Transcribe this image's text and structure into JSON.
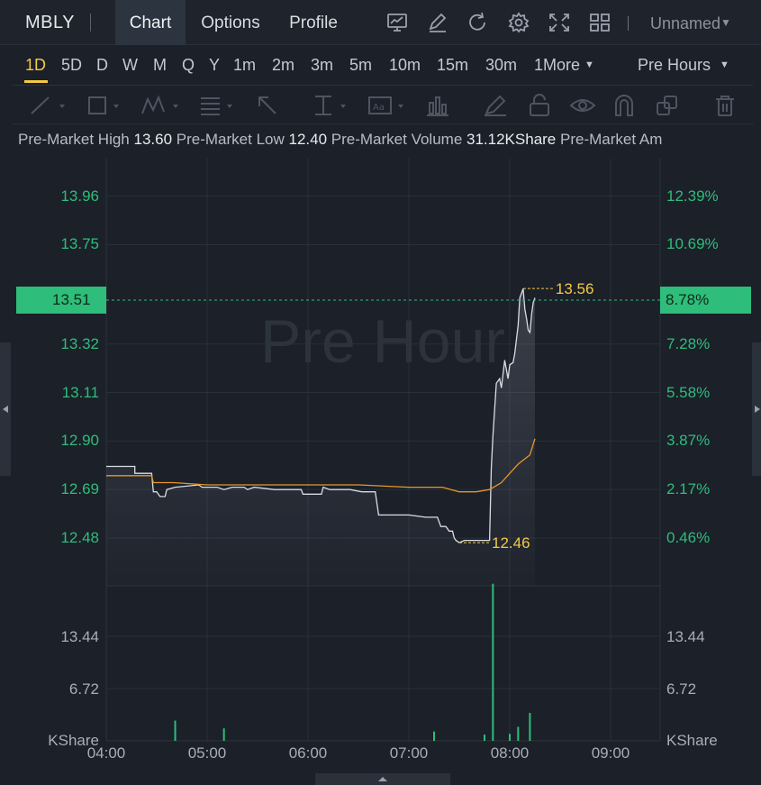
{
  "nav": {
    "symbol": "MBLY",
    "tabs": [
      "Chart",
      "Options",
      "Profile"
    ],
    "layout_name": "Unnamed",
    "toolbar_icons": [
      "indicator-icon",
      "draw-icon",
      "refresh-icon",
      "settings-icon",
      "fullscreen-icon",
      "layout-grid-icon"
    ]
  },
  "intervals": {
    "items": [
      "1D",
      "5D",
      "D",
      "W",
      "M",
      "Q",
      "Y",
      "1m",
      "2m",
      "3m",
      "5m",
      "10m",
      "15m",
      "30m",
      "1"
    ],
    "more_label": "More",
    "active": "1D",
    "session": "Pre Hours"
  },
  "drawing_tools": [
    "trend-line-icon",
    "rectangle-icon",
    "pattern-icon",
    "fib-icon",
    "arrow-icon",
    "measure-icon",
    "text-note-icon",
    "bar-pattern-icon",
    "brush-icon",
    "lock-icon",
    "eye-icon",
    "magnet-icon",
    "clone-icon",
    "trash-icon"
  ],
  "stats": {
    "high_label": "Pre-Market High",
    "high": "13.60",
    "low_label": "Pre-Market Low",
    "low": "12.40",
    "volume_label": "Pre-Market Volume",
    "volume": "31.12KShare",
    "amount_label": "Pre-Market Am"
  },
  "colors": {
    "up": "#2ebd7a",
    "price_line": "#d9dde3",
    "avg_line": "#e8962b",
    "highlight": "#f5c945"
  },
  "watermark": "Pre Hour",
  "chart_data": {
    "type": "line",
    "price_axis": [
      "13.96",
      "13.75",
      "13.51",
      "13.32",
      "13.11",
      "12.90",
      "12.69",
      "12.48"
    ],
    "percent_axis": [
      "12.39%",
      "10.69%",
      "8.78%",
      "7.28%",
      "5.58%",
      "3.87%",
      "2.17%",
      "0.46%"
    ],
    "current_price": "13.51",
    "current_percent": "8.78%",
    "max_label": "13.56",
    "min_label": "12.46",
    "ylim": [
      12.42,
      14.04
    ],
    "x_ticks": [
      "04:00",
      "05:00",
      "06:00",
      "07:00",
      "08:00",
      "09:00"
    ],
    "x_range": [
      0,
      300
    ],
    "volume_axis": [
      "13.44",
      "6.72"
    ],
    "volume_unit": "KShare",
    "volume_max": 20.2,
    "series": [
      {
        "kind": "price",
        "points": [
          [
            0,
            12.79
          ],
          [
            16,
            12.79
          ],
          [
            17,
            12.79
          ],
          [
            17,
            12.76
          ],
          [
            27,
            12.76
          ],
          [
            28,
            12.68
          ],
          [
            30,
            12.68
          ],
          [
            32,
            12.66
          ],
          [
            35,
            12.66
          ],
          [
            36,
            12.69
          ],
          [
            41,
            12.7
          ],
          [
            55,
            12.71
          ],
          [
            57,
            12.7
          ],
          [
            66,
            12.7
          ],
          [
            70,
            12.69
          ],
          [
            75,
            12.7
          ],
          [
            82,
            12.7
          ],
          [
            84,
            12.69
          ],
          [
            88,
            12.7
          ],
          [
            100,
            12.69
          ],
          [
            116,
            12.69
          ],
          [
            117,
            12.67
          ],
          [
            128,
            12.67
          ],
          [
            129,
            12.7
          ],
          [
            133,
            12.69
          ],
          [
            145,
            12.69
          ],
          [
            152,
            12.68
          ],
          [
            160,
            12.68
          ],
          [
            162,
            12.58
          ],
          [
            180,
            12.58
          ],
          [
            190,
            12.57
          ],
          [
            197,
            12.57
          ],
          [
            199,
            12.53
          ],
          [
            202,
            12.53
          ],
          [
            204,
            12.51
          ],
          [
            206,
            12.51
          ],
          [
            207,
            12.48
          ],
          [
            208,
            12.47
          ],
          [
            210,
            12.46
          ],
          [
            213,
            12.47
          ],
          [
            222,
            12.47
          ],
          [
            228,
            12.47
          ],
          [
            229,
            12.78
          ],
          [
            230,
            12.92
          ],
          [
            232,
            13.15
          ],
          [
            234,
            13.17
          ],
          [
            235,
            13.13
          ],
          [
            237,
            13.25
          ],
          [
            239,
            13.17
          ],
          [
            240,
            13.23
          ],
          [
            242,
            13.24
          ],
          [
            243,
            13.28
          ],
          [
            245,
            13.4
          ],
          [
            246,
            13.52
          ],
          [
            248,
            13.56
          ],
          [
            249,
            13.47
          ],
          [
            250,
            13.43
          ],
          [
            251,
            13.38
          ],
          [
            252,
            13.37
          ],
          [
            253,
            13.45
          ],
          [
            254,
            13.5
          ],
          [
            255,
            13.52
          ]
        ]
      },
      {
        "kind": "average",
        "points": [
          [
            0,
            12.75
          ],
          [
            27,
            12.75
          ],
          [
            28,
            12.72
          ],
          [
            40,
            12.72
          ],
          [
            60,
            12.71
          ],
          [
            90,
            12.71
          ],
          [
            120,
            12.71
          ],
          [
            150,
            12.71
          ],
          [
            180,
            12.7
          ],
          [
            200,
            12.7
          ],
          [
            205,
            12.69
          ],
          [
            210,
            12.68
          ],
          [
            220,
            12.68
          ],
          [
            228,
            12.69
          ],
          [
            235,
            12.72
          ],
          [
            240,
            12.76
          ],
          [
            245,
            12.8
          ],
          [
            252,
            12.84
          ],
          [
            255,
            12.91
          ]
        ]
      }
    ],
    "volume_bars": [
      [
        41,
        2.6
      ],
      [
        70,
        1.6
      ],
      [
        195,
        1.2
      ],
      [
        225,
        0.8
      ],
      [
        230,
        20.2
      ],
      [
        240,
        0.9
      ],
      [
        245,
        1.8
      ],
      [
        252,
        3.6
      ]
    ]
  }
}
